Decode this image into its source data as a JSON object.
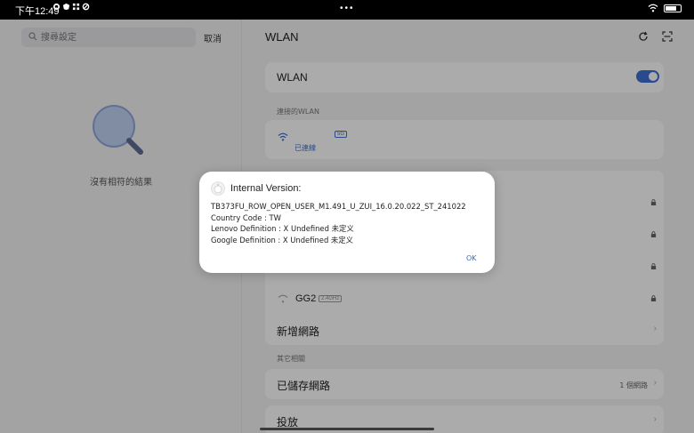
{
  "status_bar": {
    "time": "下午12:49",
    "dots": "•••"
  },
  "search": {
    "placeholder": "搜尋設定",
    "cancel_label": "取消",
    "no_results": "沒有相符的結果"
  },
  "wlan_page": {
    "title": "WLAN",
    "wlan_toggle_label": "WLAN",
    "wlan_enabled": true,
    "connected_section_label": "連接的WLAN",
    "connected_status": "已連線",
    "connected_badge": "5G",
    "networks": [
      {
        "name": "",
        "band": "",
        "locked": true
      },
      {
        "name": "",
        "band": "",
        "locked": true
      },
      {
        "name": "",
        "band": "",
        "locked": true
      },
      {
        "name": "GG2",
        "band": "2.4GHz",
        "locked": true
      }
    ],
    "add_network_label": "新增網路",
    "other_section_label": "其它相關",
    "saved_networks_label": "已儲存網路",
    "saved_networks_count": "1 個網路",
    "cast_label": "投放"
  },
  "dialog": {
    "title": "Internal Version:",
    "lines": [
      "TB373FU_ROW_OPEN_USER_M1.491_U_ZUI_16.0.20.022_ST_241022",
      "Country Code : TW",
      "Lenovo Definition : X Undefined 未定义",
      "Google Definition : X Undefined 未定义"
    ],
    "ok_label": "OK"
  },
  "colors": {
    "accent": "#3f6fd4",
    "dialog_ok": "#2f6fd6",
    "scrim": "rgba(0,0,0,0.33)"
  }
}
